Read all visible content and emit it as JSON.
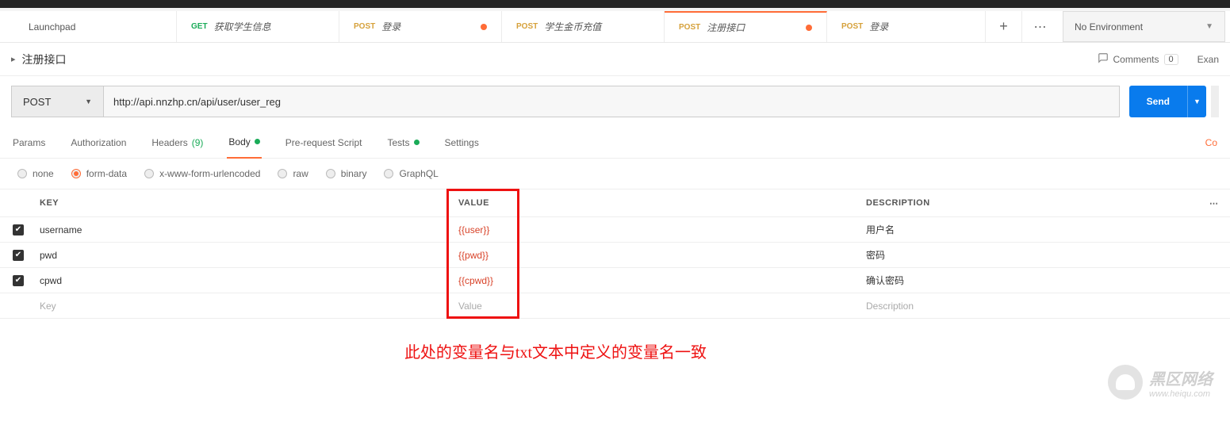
{
  "tabs": [
    {
      "method": "",
      "label": "Launchpad",
      "methodClass": "",
      "hasDot": false
    },
    {
      "method": "GET",
      "label": "获取学生信息",
      "methodClass": "get",
      "hasDot": false
    },
    {
      "method": "POST",
      "label": "登录",
      "methodClass": "post",
      "hasDot": true
    },
    {
      "method": "POST",
      "label": "学生金币充值",
      "methodClass": "post",
      "hasDot": false
    },
    {
      "method": "POST",
      "label": "注册接口",
      "methodClass": "post",
      "hasDot": true,
      "active": true
    },
    {
      "method": "POST",
      "label": "登录",
      "methodClass": "post",
      "hasDot": false
    }
  ],
  "environment": {
    "label": "No Environment"
  },
  "tab_actions": {
    "add": "+",
    "more": "⋯"
  },
  "title": {
    "caret": "▸",
    "text": "注册接口"
  },
  "titlebar": {
    "comments_label": "Comments",
    "comments_count": "0",
    "exam": "Exan"
  },
  "request": {
    "method": "POST",
    "url": "http://api.nnzhp.cn/api/user/user_reg",
    "send_label": "Send"
  },
  "subtabs": {
    "params": "Params",
    "auth": "Authorization",
    "headers": "Headers",
    "headers_count": "(9)",
    "body": "Body",
    "prereq": "Pre-request Script",
    "tests": "Tests",
    "settings": "Settings",
    "cookies": "Co"
  },
  "body_types": {
    "none": "none",
    "form_data": "form-data",
    "xwww": "x-www-form-urlencoded",
    "raw": "raw",
    "binary": "binary",
    "graphql": "GraphQL"
  },
  "table": {
    "headers": {
      "key": "KEY",
      "value": "VALUE",
      "description": "DESCRIPTION"
    },
    "rows": [
      {
        "checked": true,
        "key": "username",
        "value": "{{user}}",
        "description": "用户名"
      },
      {
        "checked": true,
        "key": "pwd",
        "value": "{{pwd}}",
        "description": "密码"
      },
      {
        "checked": true,
        "key": "cpwd",
        "value": "{{cpwd}}",
        "description": "确认密码"
      }
    ],
    "placeholder": {
      "key": "Key",
      "value": "Value",
      "description": "Description"
    }
  },
  "annotation": "此处的变量名与txt文本中定义的变量名一致",
  "watermark": {
    "cn": "黑区网络",
    "url": "www.heiqu.com"
  }
}
